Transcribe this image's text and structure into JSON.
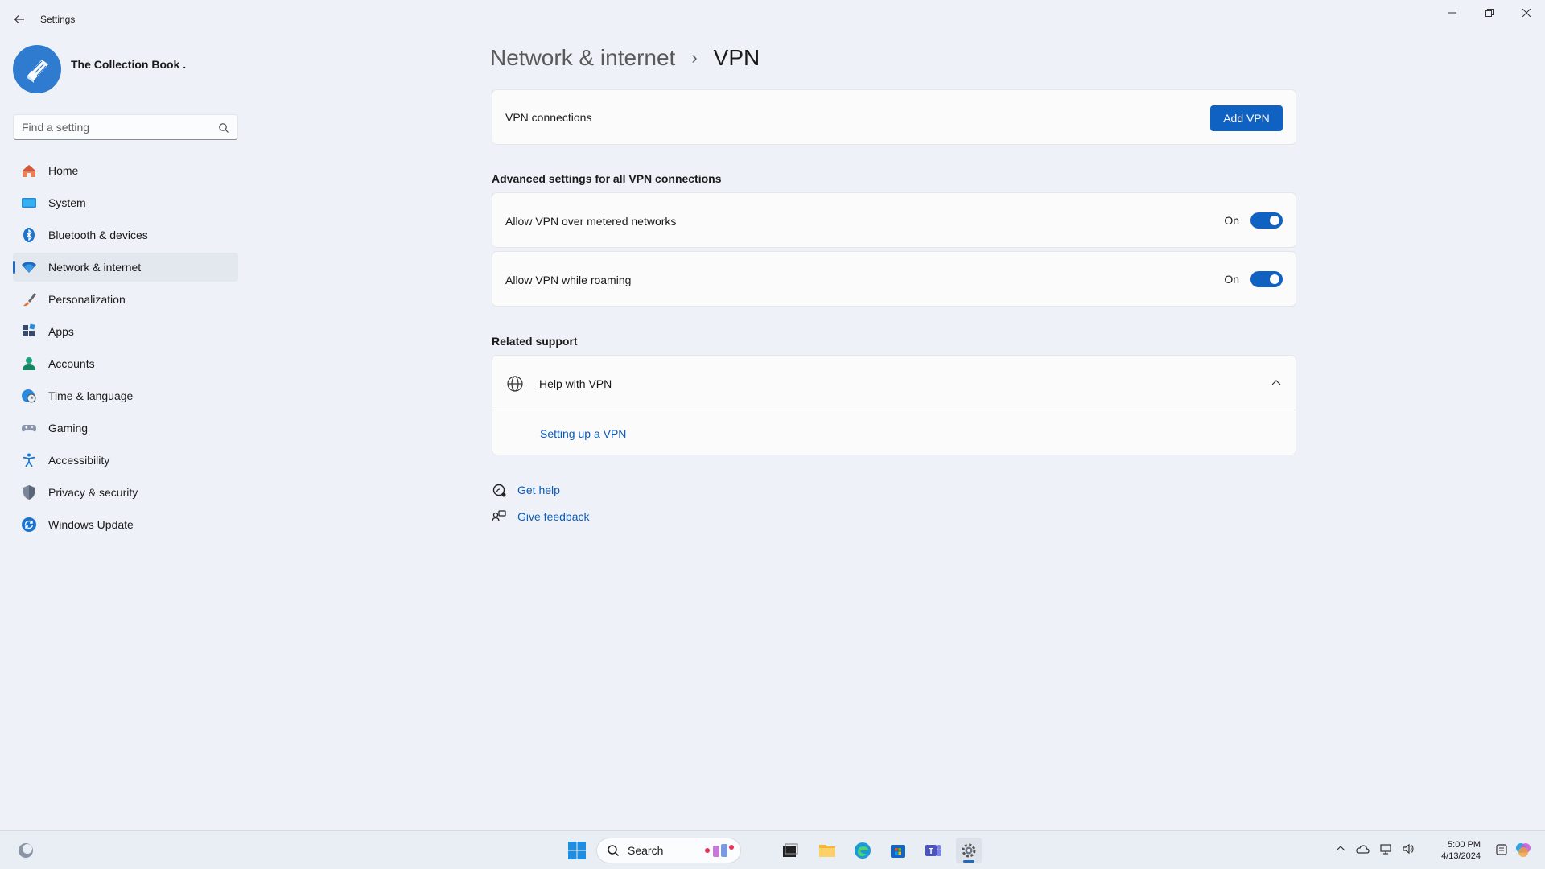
{
  "window": {
    "title": "Settings"
  },
  "profile": {
    "name": "The Collection Book ."
  },
  "search": {
    "placeholder": "Find a setting"
  },
  "sidebar": {
    "items": [
      {
        "label": "Home",
        "icon": "home-icon"
      },
      {
        "label": "System",
        "icon": "system-icon"
      },
      {
        "label": "Bluetooth & devices",
        "icon": "bluetooth-icon"
      },
      {
        "label": "Network & internet",
        "icon": "wifi-icon",
        "active": true
      },
      {
        "label": "Personalization",
        "icon": "brush-icon"
      },
      {
        "label": "Apps",
        "icon": "apps-icon"
      },
      {
        "label": "Accounts",
        "icon": "person-icon"
      },
      {
        "label": "Time & language",
        "icon": "globe-clock-icon"
      },
      {
        "label": "Gaming",
        "icon": "gamepad-icon"
      },
      {
        "label": "Accessibility",
        "icon": "accessibility-icon"
      },
      {
        "label": "Privacy & security",
        "icon": "shield-icon"
      },
      {
        "label": "Windows Update",
        "icon": "update-icon"
      }
    ]
  },
  "header": {
    "parent": "Network & internet",
    "separator": "›",
    "current": "VPN"
  },
  "vpn": {
    "connections_label": "VPN connections",
    "add_button": "Add VPN"
  },
  "advanced": {
    "title": "Advanced settings for all VPN connections",
    "metered_label": "Allow VPN over metered networks",
    "metered_state": "On",
    "roaming_label": "Allow VPN while roaming",
    "roaming_state": "On"
  },
  "support": {
    "title": "Related support",
    "help_label": "Help with VPN",
    "link_setup": "Setting up a VPN"
  },
  "footer_links": {
    "get_help": "Get help",
    "give_feedback": "Give feedback"
  },
  "taskbar": {
    "search_label": "Search",
    "time": "5:00 PM",
    "date": "4/13/2024"
  },
  "colors": {
    "accent": "#0f62c2",
    "background": "#eef2f8"
  }
}
